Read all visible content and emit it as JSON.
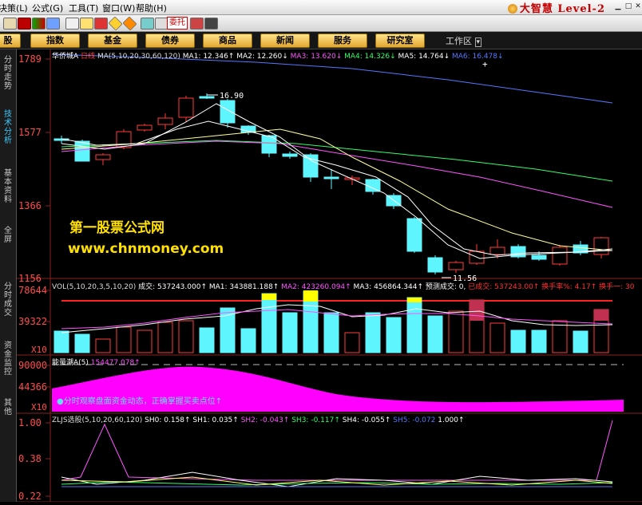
{
  "menu": {
    "items": [
      "决策(L)",
      "公式(G)",
      "工具(T)",
      "窗口(W)",
      "帮助(H)"
    ],
    "brand": "大智慧 Level-2"
  },
  "toolbar": {
    "badge": "委托"
  },
  "nav": {
    "buttons": [
      "股",
      "指数",
      "基金",
      "债券",
      "商品",
      "新闻",
      "服务",
      "研究室"
    ],
    "workzone": "工作区"
  },
  "sidebar": {
    "tabs": [
      "分时走势",
      "技术分析",
      "基本资料",
      "全屏",
      "分时成交",
      "资金监控",
      "其他"
    ],
    "active_index": 1
  },
  "price_pane": {
    "stock_name": "华侨城A",
    "period": "日线",
    "ma_params": "MA(5,10,20,30,60,120)",
    "ma": [
      {
        "label": "MA1: 12.346",
        "arrow": "↑",
        "color": "#ffffff"
      },
      {
        "label": "MA2: 12.260",
        "arrow": "↓",
        "color": "#ffffff"
      },
      {
        "label": "MA3: 13.620",
        "arrow": "↓",
        "color": "#ff55ff"
      },
      {
        "label": "MA4: 14.326",
        "arrow": "↓",
        "color": "#33ff66"
      },
      {
        "label": "MA5: 14.764",
        "arrow": "↓",
        "color": "#ffffff"
      },
      {
        "label": "MA6: 16.478",
        "arrow": "↓",
        "color": "#5577ff"
      }
    ],
    "y_ticks": [
      "1789",
      "1577",
      "1366",
      "1156"
    ],
    "high_label": "16.90",
    "low_label": "11.56"
  },
  "watermark": {
    "title": "第一股票公式网",
    "url": "www.chnmoney.com"
  },
  "volume_pane": {
    "params": "VOL(5,10,20,3,5,10,20)",
    "items": [
      {
        "label": "成交: 537243.000↑",
        "color": "#ffffff"
      },
      {
        "label": "MA1: 343881.188↑",
        "color": "#ffffff"
      },
      {
        "label": "MA2: 423260.094↑",
        "color": "#ff55ff"
      },
      {
        "label": "MA3: 456864.344↑",
        "color": "#ffffff"
      },
      {
        "label": "预测成交: 0,",
        "color": "#ffffff"
      },
      {
        "label": "已成交: 537243.00↑",
        "color": "#ff3333"
      },
      {
        "label": "换手率%: 4.17↑",
        "color": "#ff3333"
      },
      {
        "label": "换手一: 30",
        "color": "#ff3333"
      }
    ],
    "y_ticks": [
      "78644",
      "39322"
    ],
    "unit": "X10"
  },
  "energy_pane": {
    "title": "能量潮A(5)",
    "value": "154477.078↑",
    "y_ticks": [
      "90000",
      "44366"
    ],
    "unit": "X10",
    "note": "●分时观察盘面资金动态，正确掌握买卖点位↑"
  },
  "zljs_pane": {
    "title": "ZLJS选股(5,10,20,60,120)",
    "items": [
      {
        "label": "SH0: 0.158↑",
        "color": "#ffffff"
      },
      {
        "label": "SH1: 0.035↑",
        "color": "#ffffff"
      },
      {
        "label": "SH2: -0.043↑",
        "color": "#ff55ff"
      },
      {
        "label": "SH3: -0.117↑",
        "color": "#33ff66"
      },
      {
        "label": "SH4: -0.055↑",
        "color": "#ffffff"
      },
      {
        "label": "SH5: -0.072",
        "color": "#5577ff"
      },
      {
        "label": "1.000↑",
        "color": "#ffffff"
      }
    ],
    "y_ticks": [
      "1.00",
      "0.38",
      "0.22"
    ]
  },
  "colors": {
    "up": "#ff3a3a",
    "down": "#5ff5ff",
    "axis": "#8a2020"
  }
}
